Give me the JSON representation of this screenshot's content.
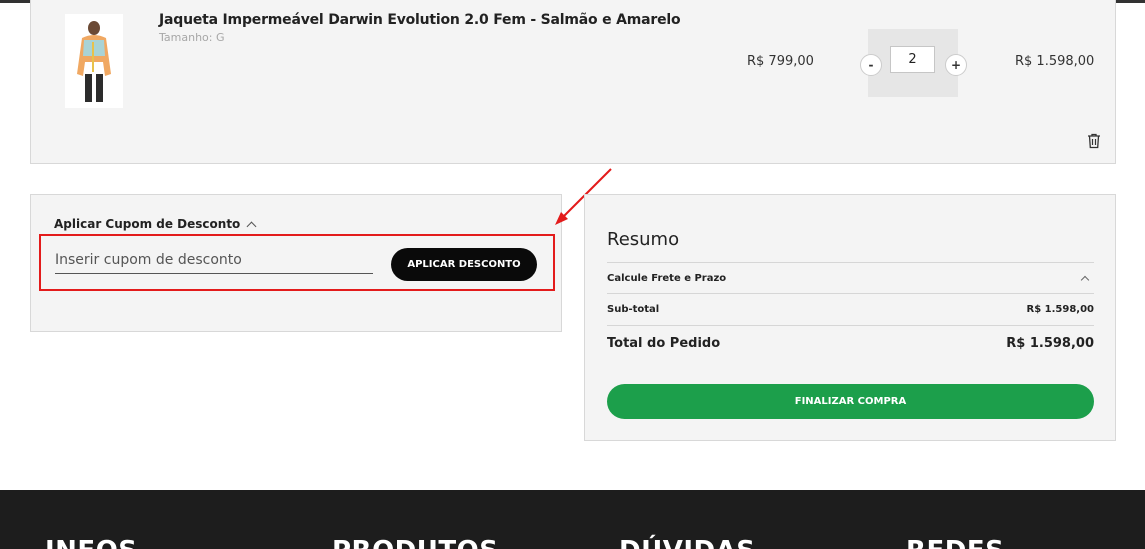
{
  "cart_item": {
    "product_name": "Jaqueta Impermeável Darwin Evolution 2.0 Fem - Salmão e Amarelo",
    "size_label": "Tamanho:",
    "size_value": "G",
    "unit_price": "R$ 799,00",
    "quantity_minus": "-",
    "quantity": "2",
    "quantity_plus": "+",
    "line_total": "R$ 1.598,00",
    "remove_icon": "trash-icon"
  },
  "coupon": {
    "title": "Aplicar Cupom de Desconto",
    "input_placeholder": "Inserir cupom de desconto",
    "apply_label": "APLICAR DESCONTO",
    "highlight_color": "#e31b1b"
  },
  "summary": {
    "title": "Resumo",
    "shipping_label": "Calcule Frete e Prazo",
    "subtotal_label": "Sub-total",
    "subtotal_value": "R$ 1.598,00",
    "total_label": "Total do Pedido",
    "total_value": "R$ 1.598,00",
    "checkout_label": "FINALIZAR COMPRA",
    "checkout_color": "#1c9f4b"
  },
  "footer": {
    "headings": [
      "INFOS",
      "PRODUTOS",
      "DÚVIDAS",
      "REDES"
    ]
  }
}
